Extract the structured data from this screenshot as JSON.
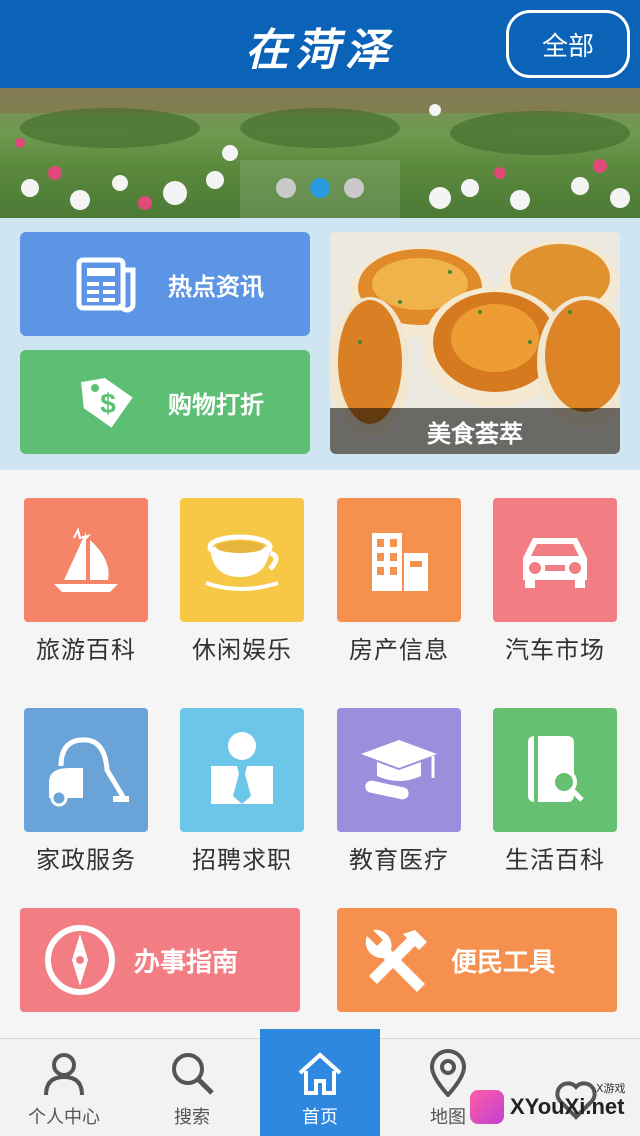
{
  "header": {
    "title": "在菏泽",
    "all_button": "全部"
  },
  "banner": {
    "slide_count": 3,
    "active_slide": 2
  },
  "features": {
    "news": "热点资讯",
    "shopping": "购物打折",
    "food": "美食荟萃"
  },
  "grid": {
    "items": [
      {
        "label": "旅游百科",
        "icon": "sailboat-icon",
        "color": "#f58468"
      },
      {
        "label": "休闲娱乐",
        "icon": "coffee-cup-icon",
        "color": "#f6c846"
      },
      {
        "label": "房产信息",
        "icon": "building-icon",
        "color": "#f5904e"
      },
      {
        "label": "汽车市场",
        "icon": "car-icon",
        "color": "#f27e84"
      },
      {
        "label": "家政服务",
        "icon": "vacuum-cleaner-icon",
        "color": "#6aa3d8"
      },
      {
        "label": "招聘求职",
        "icon": "person-tie-icon",
        "color": "#6bc6e8"
      },
      {
        "label": "教育医疗",
        "icon": "graduation-cap-icon",
        "color": "#9a8fdc"
      },
      {
        "label": "生活百科",
        "icon": "book-search-icon",
        "color": "#66c071"
      }
    ],
    "guide": "办事指南",
    "tools": "便民工具"
  },
  "bottom_nav": {
    "items": [
      {
        "label": "个人中心",
        "icon": "user-icon"
      },
      {
        "label": "搜索",
        "icon": "search-icon"
      },
      {
        "label": "首页",
        "icon": "home-icon"
      },
      {
        "label": "地图",
        "icon": "map-pin-icon"
      },
      {
        "label": "",
        "icon": "heart-icon"
      }
    ],
    "active_index": 2
  },
  "watermark": {
    "text": "XYouXi.net",
    "small": "X游戏"
  }
}
